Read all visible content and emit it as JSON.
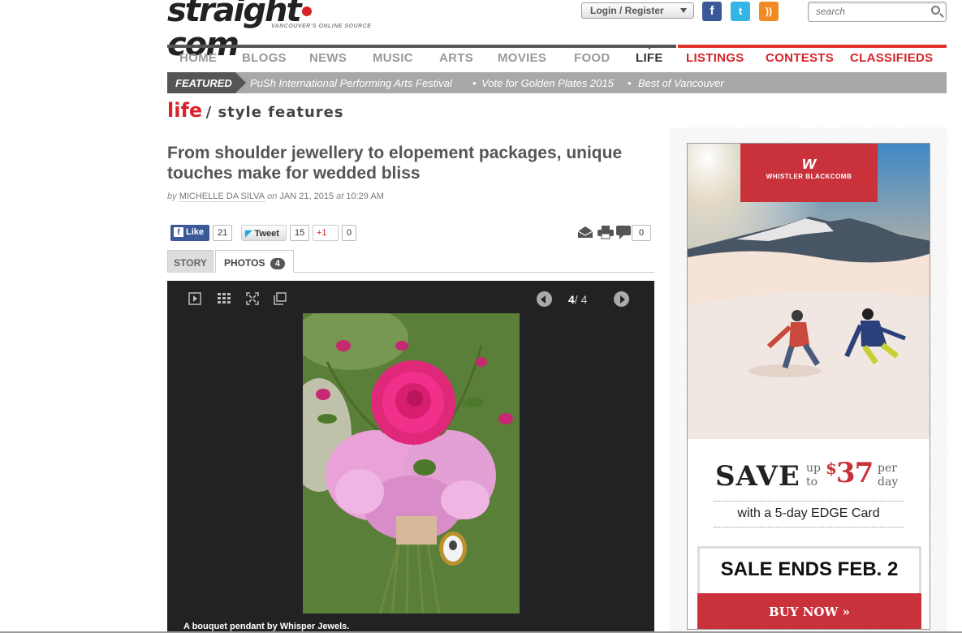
{
  "header": {
    "logo_word_a": "straight",
    "logo_word_b": "com",
    "logo_tagline": "VANCOUVER'S ONLINE SOURCE",
    "login_label": "Login / Register",
    "search_placeholder": "search"
  },
  "nav": {
    "items": [
      "HOME",
      "BLOGS",
      "NEWS",
      "MUSIC",
      "ARTS",
      "MOVIES",
      "FOOD",
      "LIFE"
    ],
    "red_items": [
      "LISTINGS",
      "CONTESTS",
      "CLASSIFIEDS"
    ],
    "active": "LIFE"
  },
  "featured": {
    "label": "FEATURED",
    "items": [
      "PuSh International Performing Arts Festival",
      "Vote for Golden Plates 2015",
      "Best of Vancouver"
    ]
  },
  "section": {
    "name": "life",
    "sub": "/ style features"
  },
  "article": {
    "headline": "From shoulder jewellery to elopement packages, unique touches make for wedded bliss",
    "by": "by",
    "author": "MICHELLE DA SILVA",
    "on": "on",
    "date": "JAN 21, 2015",
    "at": "at",
    "time": "10:29 AM"
  },
  "share": {
    "like_label": "Like",
    "like_count": "21",
    "tweet_label": "Tweet",
    "tweet_count": "15",
    "gplus_label": "+1",
    "gplus_count": "0",
    "comments_count": "0"
  },
  "tabs": {
    "story": "STORY",
    "photos": "PHOTOS",
    "photos_count": "4"
  },
  "viewer": {
    "current": "4",
    "sep": "/",
    "total": "4",
    "caption": "A bouquet pendant by Whisper Jewels."
  },
  "ad": {
    "brand_name": "WHISTLER BLACKCOMB",
    "save": "SAVE",
    "up": "up",
    "to": "to",
    "currency": "$",
    "amount": "37",
    "per": "per",
    "day": "day",
    "edge": "with a 5-day EDGE Card",
    "ends": "SALE ENDS FEB. 2",
    "buy": "BUY NOW »"
  }
}
